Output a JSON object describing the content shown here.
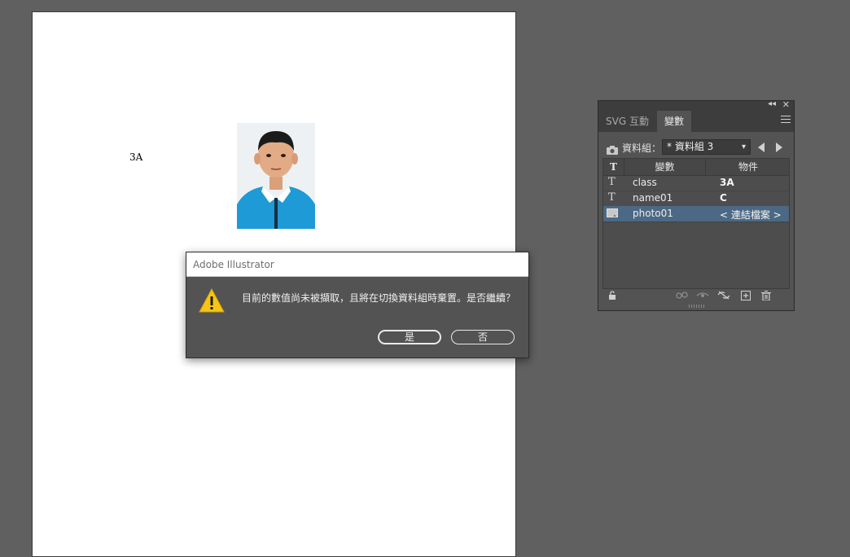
{
  "artboard": {
    "text_frame": "3A"
  },
  "dialog": {
    "title": "Adobe Illustrator",
    "message": "目前的數值尚未被擷取，且將在切換資料組時棄置。是否繼續？",
    "yes_label": "是",
    "no_label": "否",
    "icon": "warning-icon"
  },
  "panel": {
    "tabs": [
      "SVG 互動",
      "變數"
    ],
    "active_tab": "變數",
    "dataset_label": "資料組：",
    "dataset_value": "* 資料組 3",
    "columns": [
      "變數",
      "物件"
    ],
    "type_column_header": "T",
    "rows": [
      {
        "type_icon": "T",
        "name": "class",
        "object": "3A"
      },
      {
        "type_icon": "T",
        "name": "name01",
        "object": "C"
      },
      {
        "type_icon": "image-icon",
        "name": "photo01",
        "object": "< 連結檔案 >"
      }
    ],
    "selected_row": "photo01"
  },
  "colors": {
    "canvas_bg": "#606060",
    "selection": "#4b6984",
    "warning": "#f5c518"
  }
}
